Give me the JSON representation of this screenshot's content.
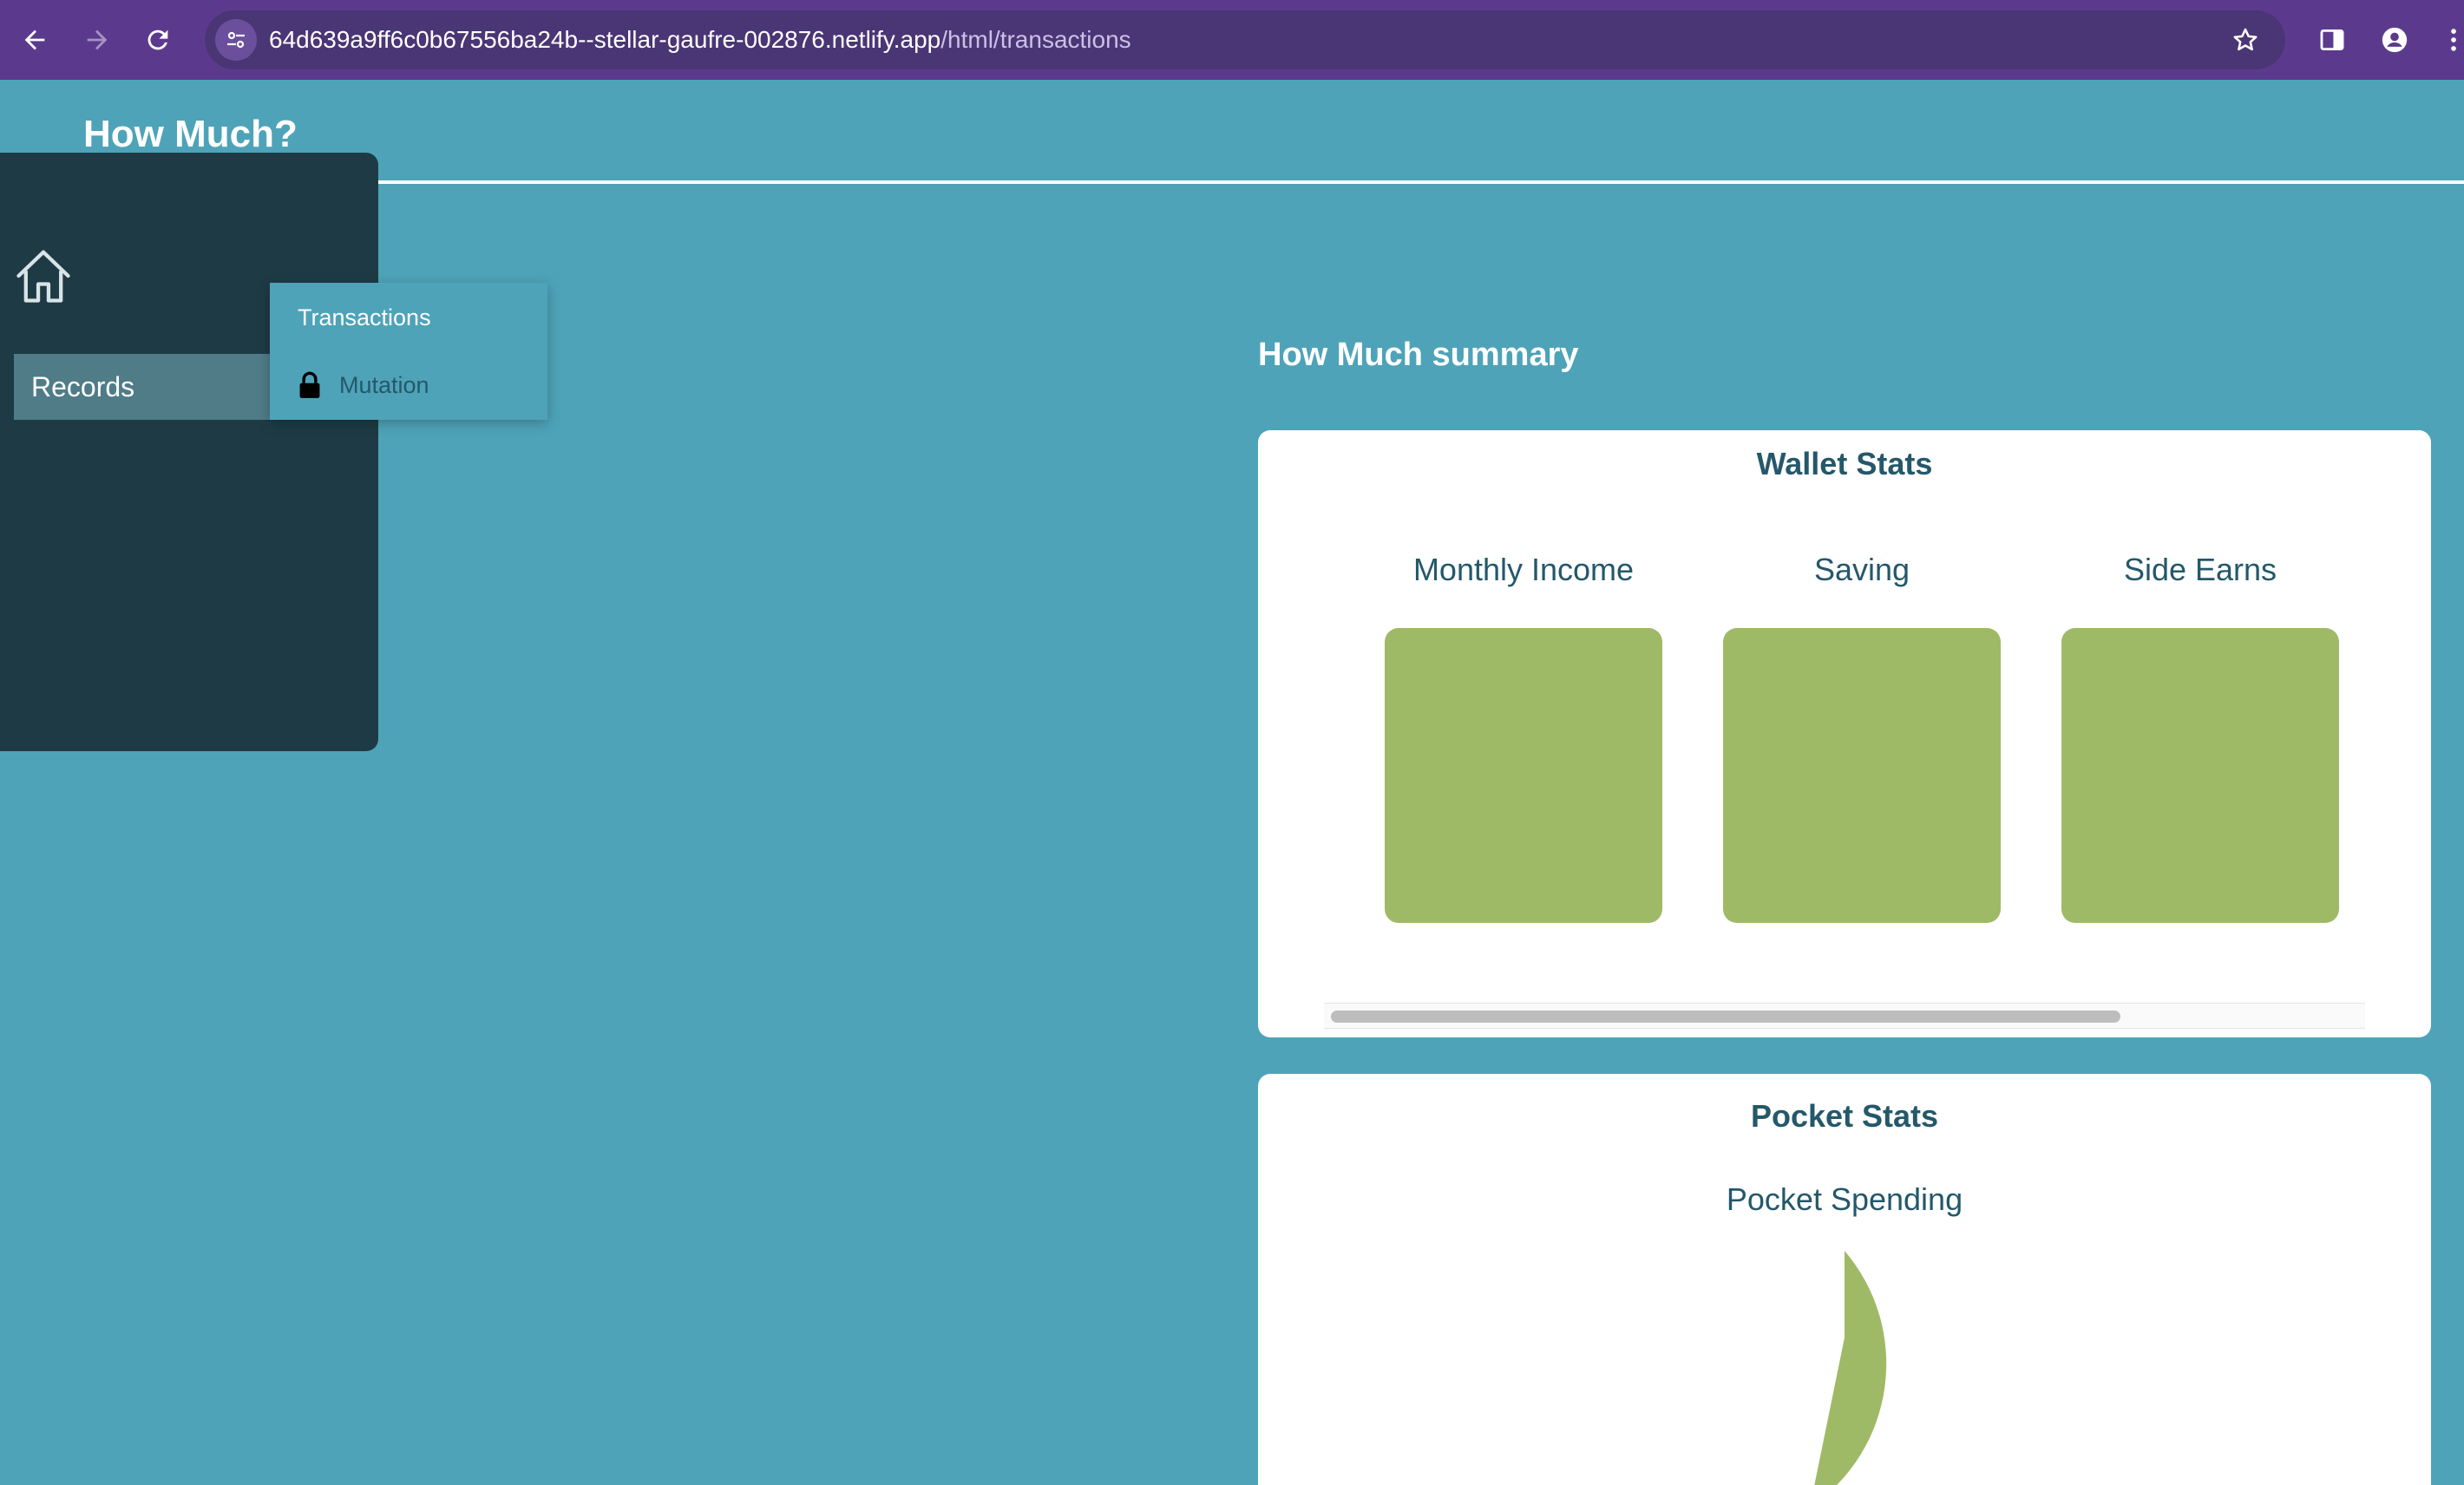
{
  "browser": {
    "url_host": "64d639a9ff6c0b67556ba24b--stellar-gaufre-002876.netlify.app",
    "url_path": "/html/transactions",
    "back_icon": "arrow-left",
    "forward_icon": "arrow-right",
    "reload_icon": "reload",
    "bookmark_icon": "star",
    "side_panel_icon": "side-panel",
    "profile_icon": "profile",
    "menu_icon": "kebab-menu",
    "theme_color": "#5b3a8e"
  },
  "header": {
    "title": "How Much?"
  },
  "sidebar": {
    "home_icon": "home",
    "records_label": "Records",
    "submenu": [
      {
        "label": "Transactions"
      },
      {
        "label": "Mutation",
        "icon": "lock"
      }
    ]
  },
  "summary": {
    "title": "How Much summary",
    "wallet": {
      "title": "Wallet Stats",
      "stats": [
        {
          "label": "Monthly Income"
        },
        {
          "label": "Saving"
        },
        {
          "label": "Side Earns"
        }
      ],
      "scroll_position": 0
    },
    "pocket": {
      "title": "Pocket Stats",
      "subtitle": "Pocket Spending"
    }
  },
  "colors": {
    "page_background": "#4ea3b8",
    "sidebar_background": "#1e3b45",
    "chart_fill": "#9fba66",
    "heading_text": "#24586a"
  }
}
